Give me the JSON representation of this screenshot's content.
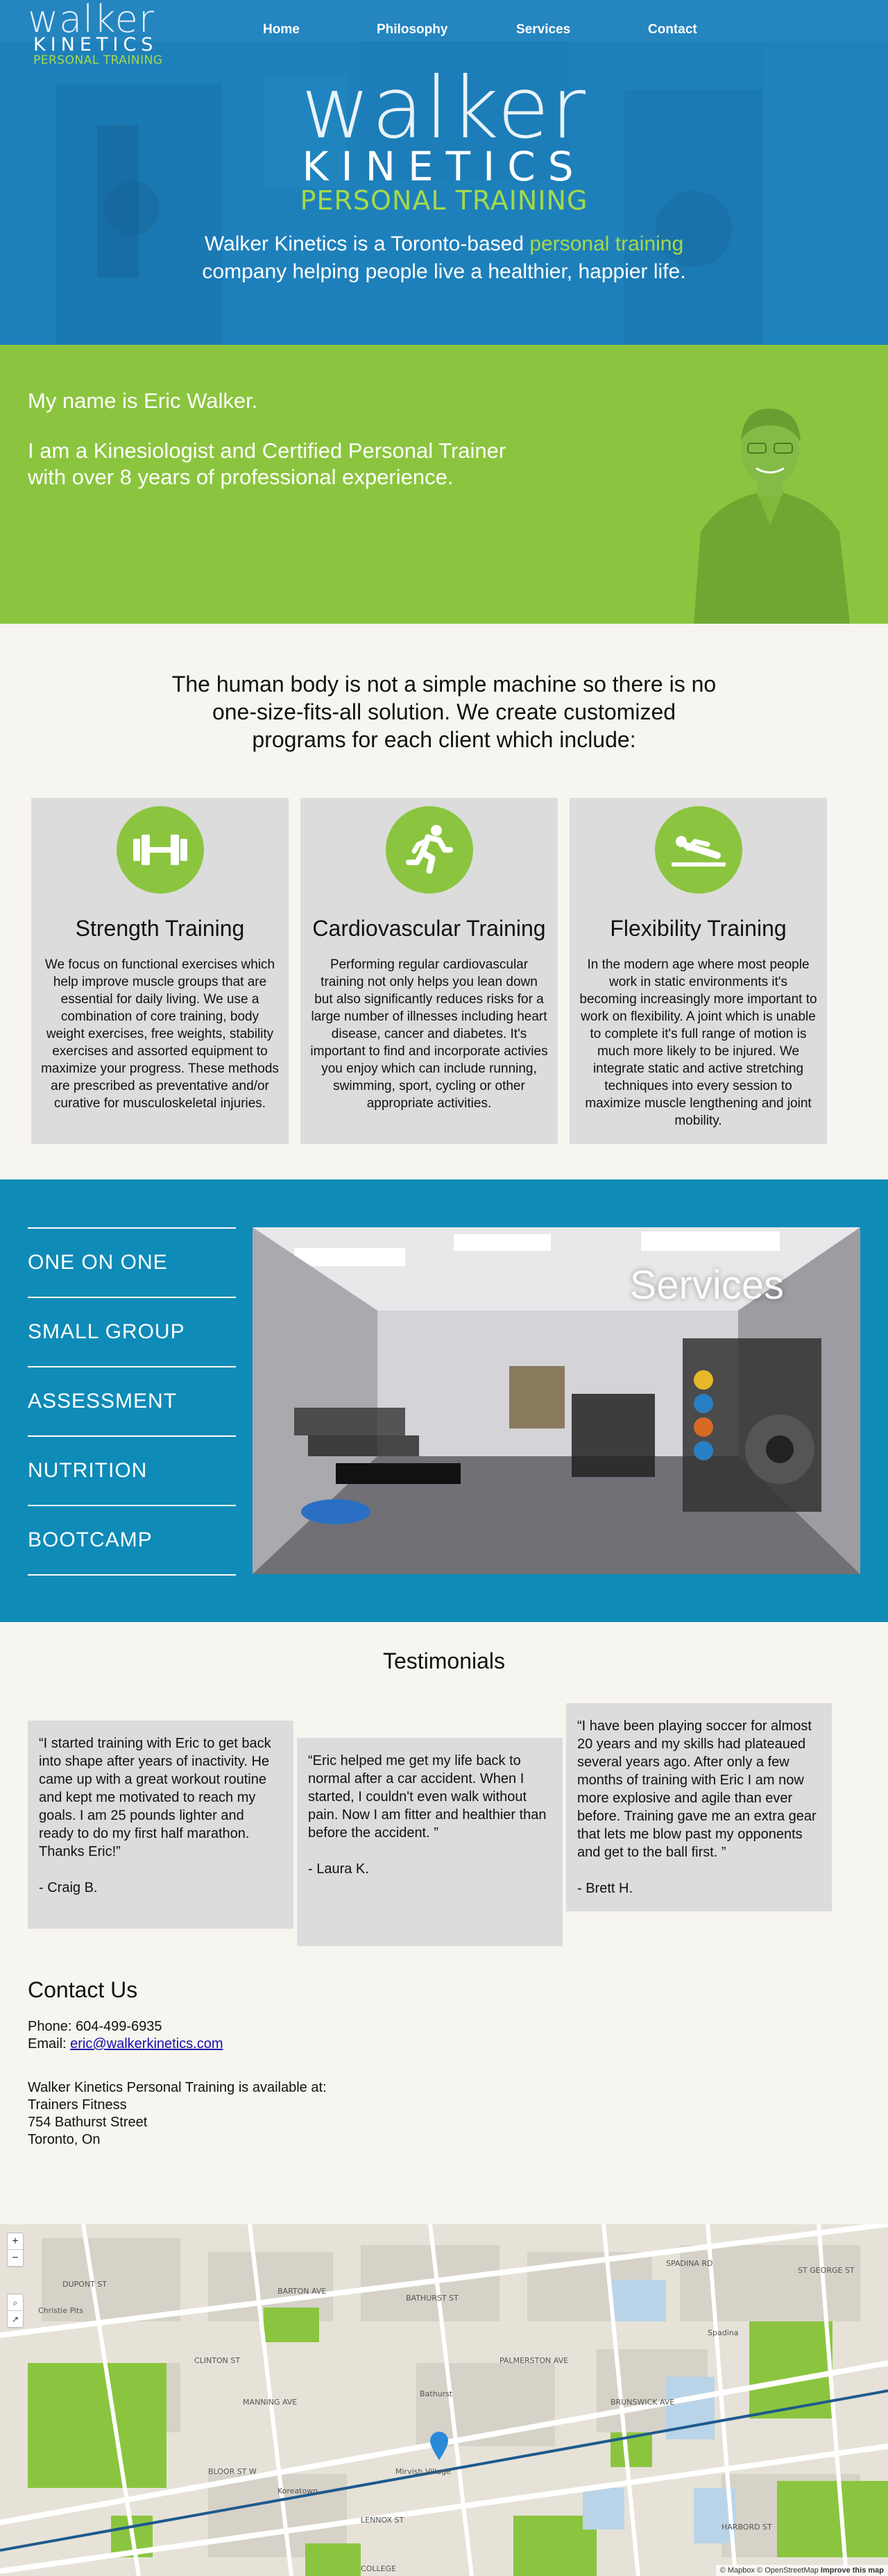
{
  "header": {
    "logo": {
      "word": "walker",
      "kinetics": "KINETICS",
      "sub": "PERSONAL TRAINING"
    },
    "nav": [
      {
        "label": "Home"
      },
      {
        "label": "Philosophy"
      },
      {
        "label": "Services"
      },
      {
        "label": "Contact"
      }
    ],
    "tagline_pre": "Walker Kinetics is a Toronto-based ",
    "tagline_highlight": "personal training",
    "tagline_line2": "company helping people live a healthier, happier life."
  },
  "about": {
    "line1": "My name is Eric Walker.",
    "line2": "I am a Kinesiologist and Certified Personal Trainer",
    "line3": "with over 8 years of professional experience."
  },
  "programs": {
    "intro": [
      "The human body is not a simple machine so there is no",
      "one-size-fits-all solution. We create customized",
      "programs for each client which include:"
    ],
    "cards": [
      {
        "icon": "dumbbell-icon",
        "title": "Strength Training",
        "text": "We focus on functional exercises which help improve muscle groups that are essential for daily living. We use a combination of core training, body weight exercises, free weights, stability exercises and assorted equipment to maximize your progress. These methods are prescribed as preventative and/or curative for musculoskeletal injuries."
      },
      {
        "icon": "running-icon",
        "title": "Cardiovascular Training",
        "text": "Performing regular cardiovascular training not only helps you lean down but also significantly reduces risks for a large number of illnesses including heart disease, cancer and diabetes. It's important to find and incorporate activies you enjoy which can include running, swimming, sport, cycling or other appropriate activities."
      },
      {
        "icon": "stretching-icon",
        "title": "Flexibility Training",
        "text": "In the modern age where most people work in static environments it's becoming increasingly more important to work on flexibility. A joint which is unable to complete it's full range of motion is much more likely to be injured. We integrate static and active stretching techniques into every session to maximize muscle lengthening and joint mobility."
      }
    ]
  },
  "services": {
    "title": "Services",
    "items": [
      "ONE ON ONE",
      "SMALL GROUP",
      "ASSESSMENT",
      "NUTRITION",
      "BOOTCAMP"
    ]
  },
  "testimonials": {
    "heading": "Testimonials",
    "items": [
      {
        "quote": "“I started training with Eric to get back into shape after years of inactivity. He came up with a great workout routine and kept me motivated to reach my goals. I am 25 pounds lighter and ready to do my first half marathon. Thanks Eric!”",
        "author": "- Craig B."
      },
      {
        "quote": "“Eric helped me get my life back to normal after a car accident. When I started, I couldn't even walk without pain. Now I am fitter and healthier than before the accident. ”",
        "author": "- Laura K."
      },
      {
        "quote": "“I have been playing soccer for almost 20 years and my skills had plateaued several years ago. After only a few months of training with Eric I am now more explosive and agile than ever before. Training gave me an extra gear that lets me blow past my opponents and get to the ball first. ”",
        "author": "- Brett H."
      }
    ]
  },
  "contact": {
    "heading": "Contact Us",
    "phone": "Phone: 604-499-6935",
    "email_label": "Email: ",
    "email": "eric@walkerkinetics.com",
    "available": "Walker Kinetics Personal Training is available at:",
    "venue": "Trainers Fitness",
    "street": "754 Bathurst Street",
    "city": "Toronto, On"
  },
  "map": {
    "zoom_in": "+",
    "zoom_out": "−",
    "attribution": "© Mapbox © OpenStreetMap",
    "improve": "Improve this map",
    "labels": [
      "BLOOR ST W",
      "Koreatown",
      "Mirvish Village",
      "Christie Pits",
      "BATHURST ST",
      "HARBORD ST",
      "Bathurst",
      "Spadina",
      "LENNOX ST",
      "DUPONT ST",
      "BARTON AVE",
      "CLINTON ST",
      "MANNING AVE",
      "PALMERSTON AVE",
      "BRUNSWICK AVE",
      "SPADINA RD",
      "ST GEORGE ST",
      "COLLEGE"
    ]
  },
  "colors": {
    "green": "#8bc53f",
    "blue": "#0f8bb8",
    "card": "#dcdcdc"
  }
}
